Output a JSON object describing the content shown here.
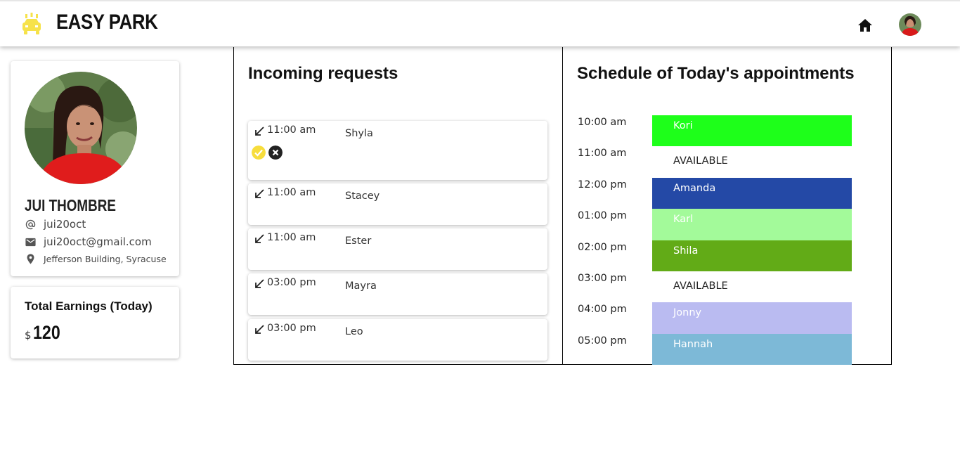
{
  "header": {
    "brand": "EASY PARK",
    "logo_icon": "taxi-icon",
    "home_icon": "home-icon"
  },
  "profile": {
    "name": "JUI THOMBRE",
    "username": "jui20oct",
    "email": "jui20oct@gmail.com",
    "location": "Jefferson Building, Syracuse"
  },
  "earnings": {
    "title": "Total Earnings (Today)",
    "currency": "$",
    "amount": "120"
  },
  "incoming": {
    "title": "Incoming requests",
    "requests": [
      {
        "time": "11:00 am",
        "name": "Shyla"
      },
      {
        "time": "11:00 am",
        "name": "Stacey"
      },
      {
        "time": "11:00 am",
        "name": "Ester"
      },
      {
        "time": "03:00 pm",
        "name": "Mayra"
      },
      {
        "time": "03:00 pm",
        "name": "Leo"
      }
    ]
  },
  "schedule": {
    "title": "Schedule of Today's appointments",
    "slots": [
      {
        "time": "10:00 am",
        "label": "Kori",
        "color": "#1eff1a",
        "text_color": "#ffffff"
      },
      {
        "time": "11:00 am",
        "label": "AVAILABLE",
        "color": "#ffffff",
        "text_color": "#222222"
      },
      {
        "time": "12:00 pm",
        "label": "Amanda",
        "color": "#2449a6",
        "text_color": "#ffffff"
      },
      {
        "time": "01:00 pm",
        "label": "Karl",
        "color": "#a3fa9a",
        "text_color": "#ffffff"
      },
      {
        "time": "02:00 pm",
        "label": "Shila",
        "color": "#62ab17",
        "text_color": "#ffffff"
      },
      {
        "time": "03:00 pm",
        "label": "AVAILABLE",
        "color": "#ffffff",
        "text_color": "#222222"
      },
      {
        "time": "04:00 pm",
        "label": "Jonny",
        "color": "#babbf1",
        "text_color": "#ffffff"
      },
      {
        "time": "05:00 pm",
        "label": "Hannah",
        "color": "#7db9d7",
        "text_color": "#ffffff"
      }
    ]
  }
}
